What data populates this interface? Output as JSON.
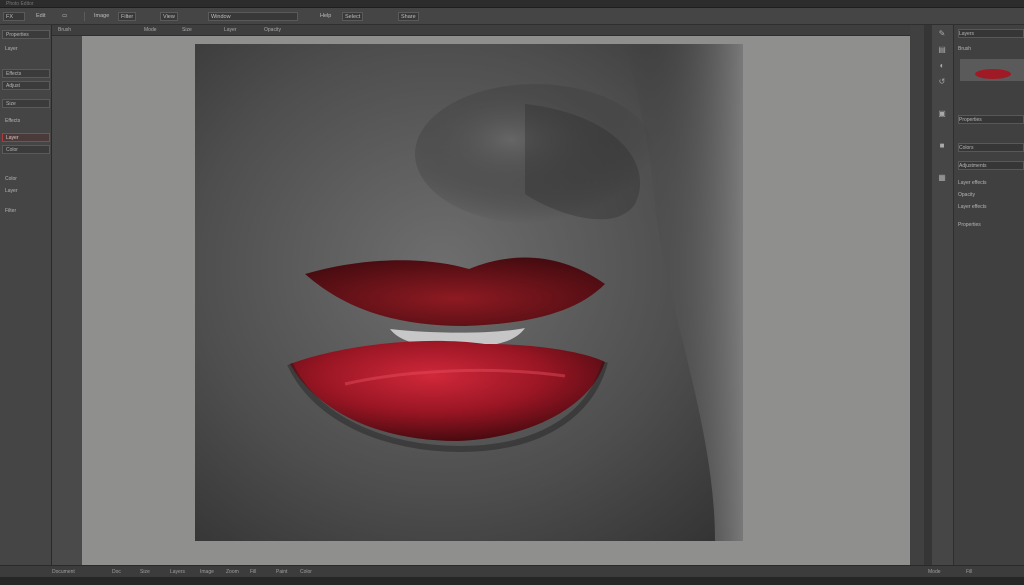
{
  "app": {
    "title": "Photo Editor"
  },
  "menubar": {
    "items": [
      "FX",
      "Edit",
      "▭",
      "Image",
      "Filter",
      "View",
      "Window",
      "Help",
      "Select",
      "Share"
    ]
  },
  "options_bar": {
    "items": [
      "Brush",
      "Mode",
      "Size",
      "Layer",
      "Opacity"
    ]
  },
  "left_panel": {
    "items": [
      "Properties",
      "Layer",
      "Effects",
      "Adjust",
      "Size",
      "Effects",
      "Layer",
      "Color",
      "Color",
      "Layer",
      "Filter"
    ]
  },
  "right_panel": {
    "header": "Layers",
    "tab": "Brush",
    "items": [
      "Properties",
      "Colors",
      "Adjustments",
      "Layer effects",
      "Opacity",
      "Layer effects",
      "Properties"
    ]
  },
  "status_bar": {
    "items": [
      "Document",
      "Doc",
      "Size",
      "Layers",
      "Image",
      "Zoom",
      "Fill",
      "Paint",
      "Color",
      "Mode",
      "Fill"
    ]
  },
  "colors": {
    "accent": "#b03a3a",
    "panel": "#454545",
    "canvas": "#8f8f8d"
  },
  "document": {
    "subject": "red-lips-closeup"
  }
}
